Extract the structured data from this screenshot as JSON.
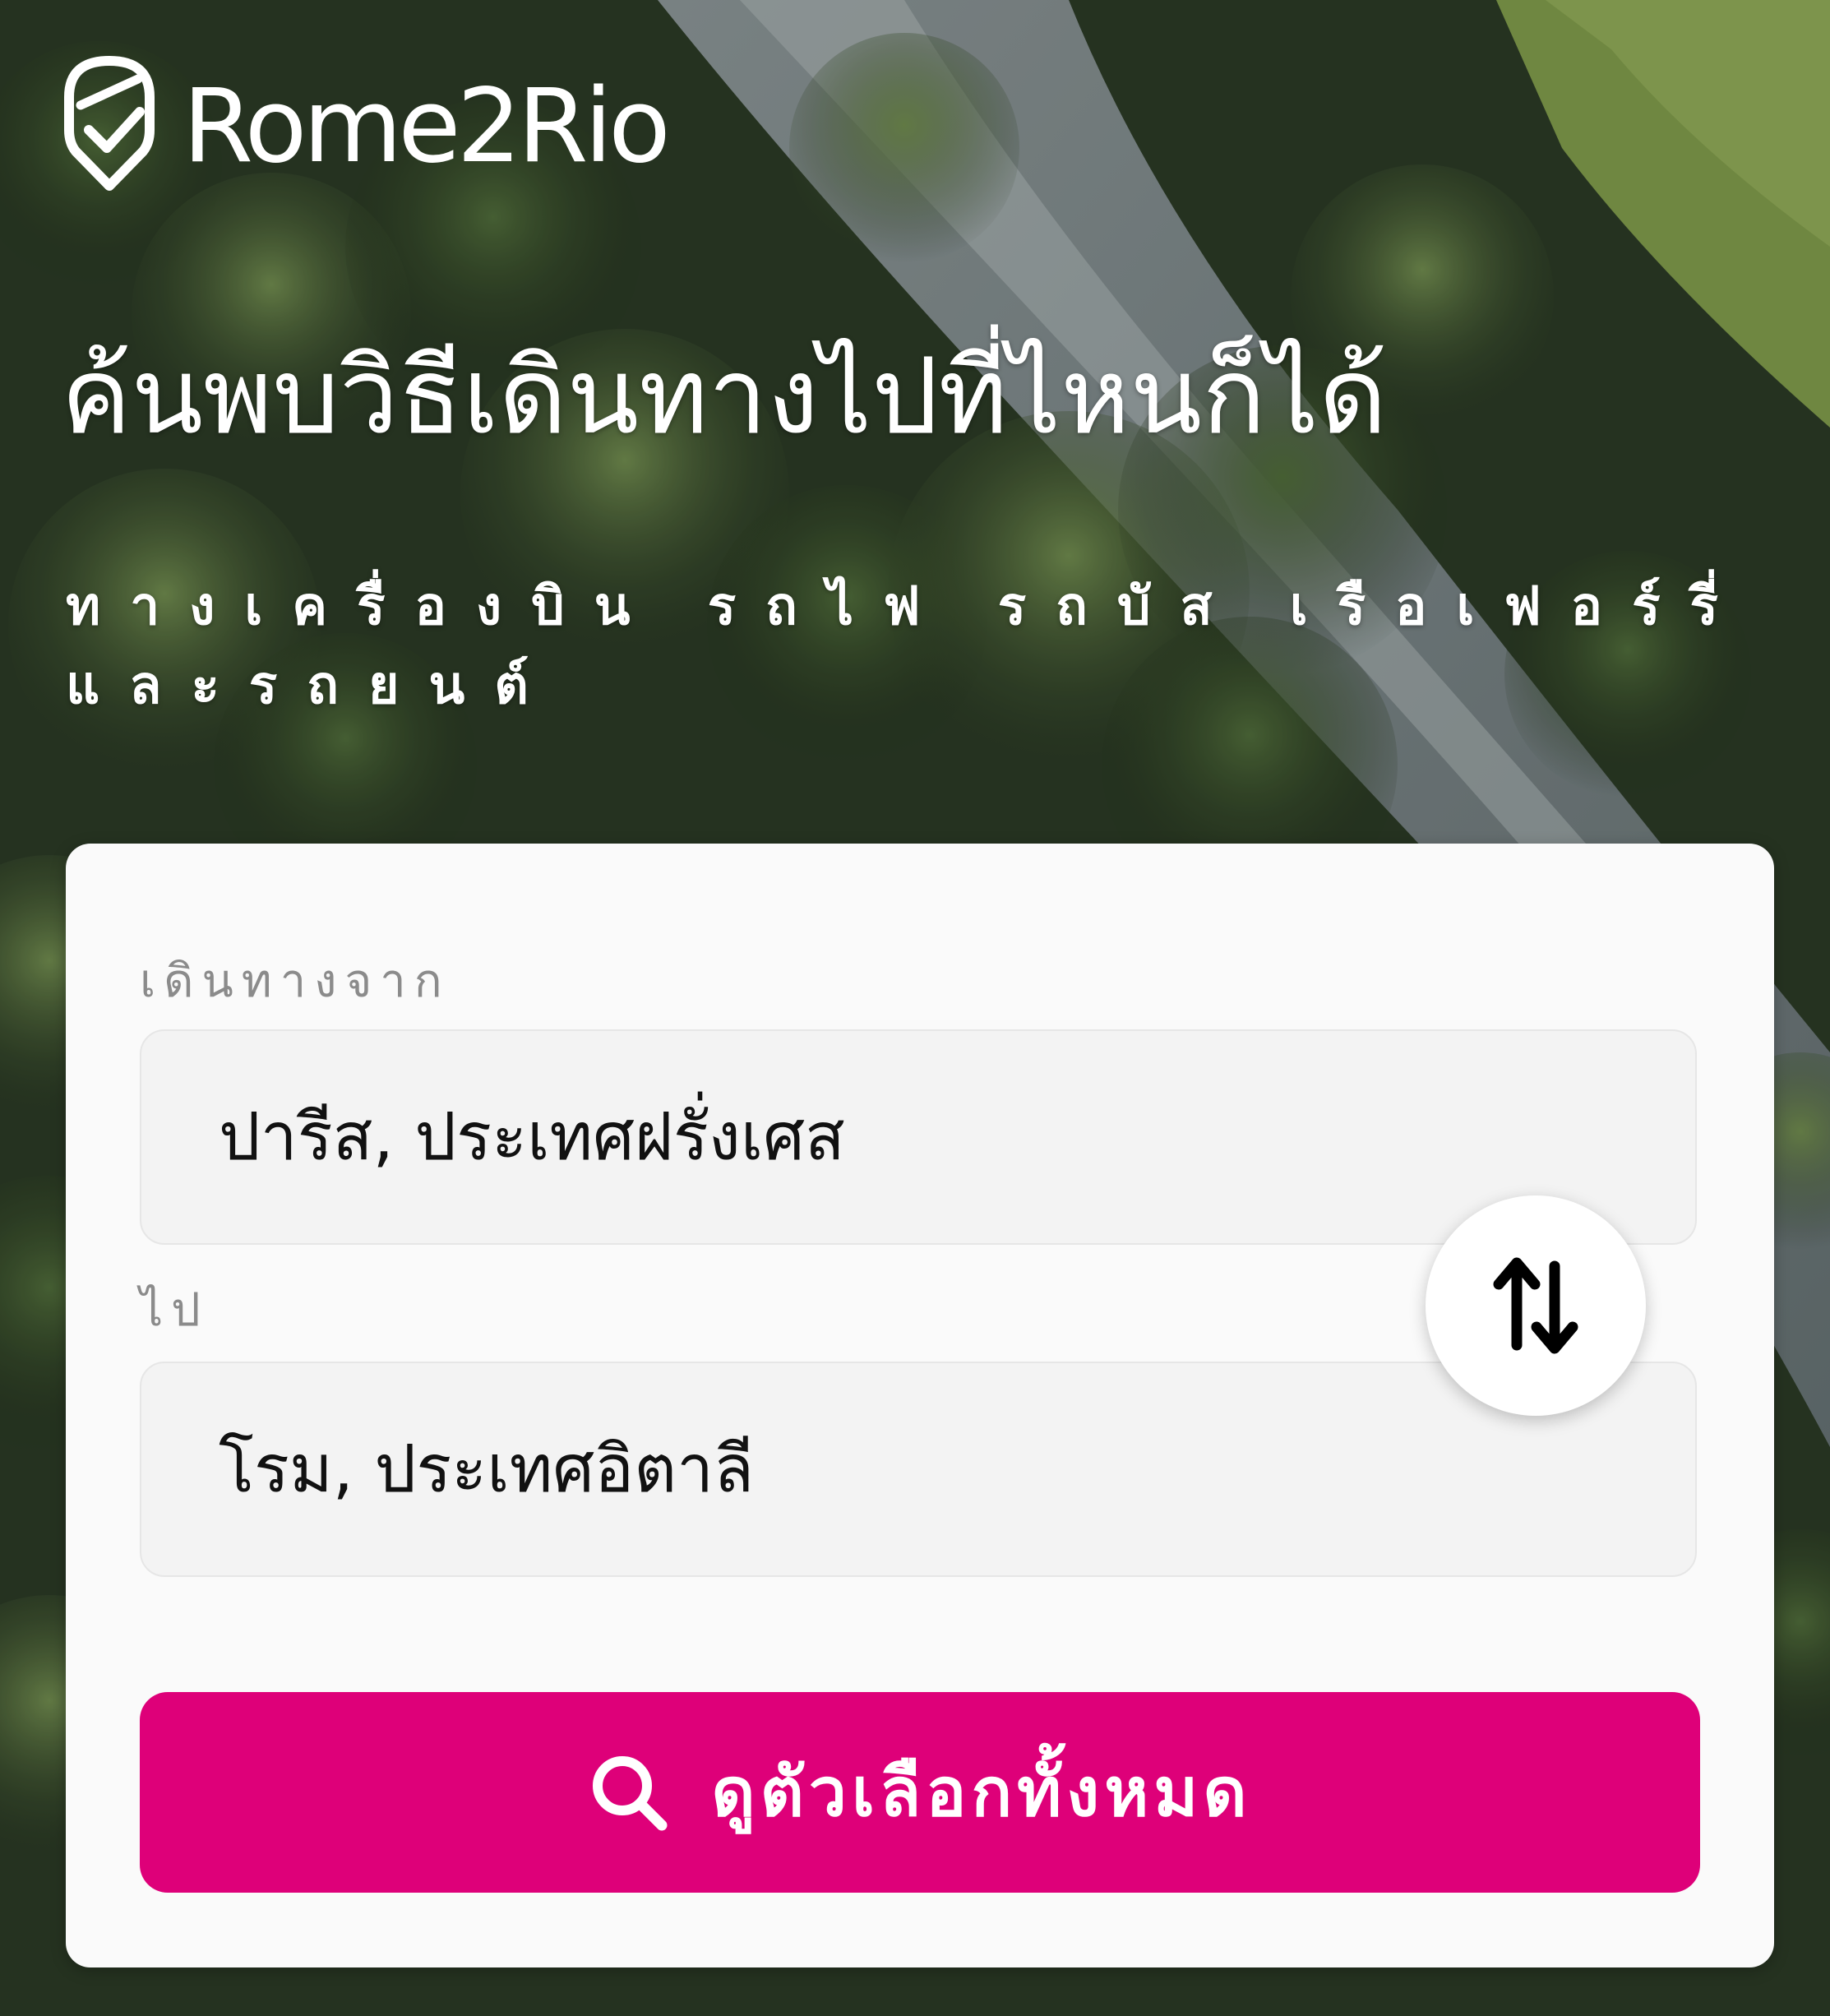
{
  "brand": {
    "name": "Rome2Rio",
    "color": "#de0079"
  },
  "hero": {
    "headline": "ค้นพบวิธีเดินทางไปที่ไหนก็ได้",
    "subhead": "ทางเครื่องบิน รถไฟ รถบัส เรือเฟอร์รี่ และรถยนต์"
  },
  "search_form": {
    "from": {
      "label": "เดินทางจาก",
      "value": "ปารีส, ประเทศฝรั่งเศส"
    },
    "to": {
      "label": "ไป",
      "value": "โรม, ประเทศอิตาลี"
    },
    "swap_icon": "swap-vertical-arrows-icon",
    "submit": {
      "label": "ดูตัวเลือกทั้งหมด",
      "icon": "search-icon"
    }
  }
}
